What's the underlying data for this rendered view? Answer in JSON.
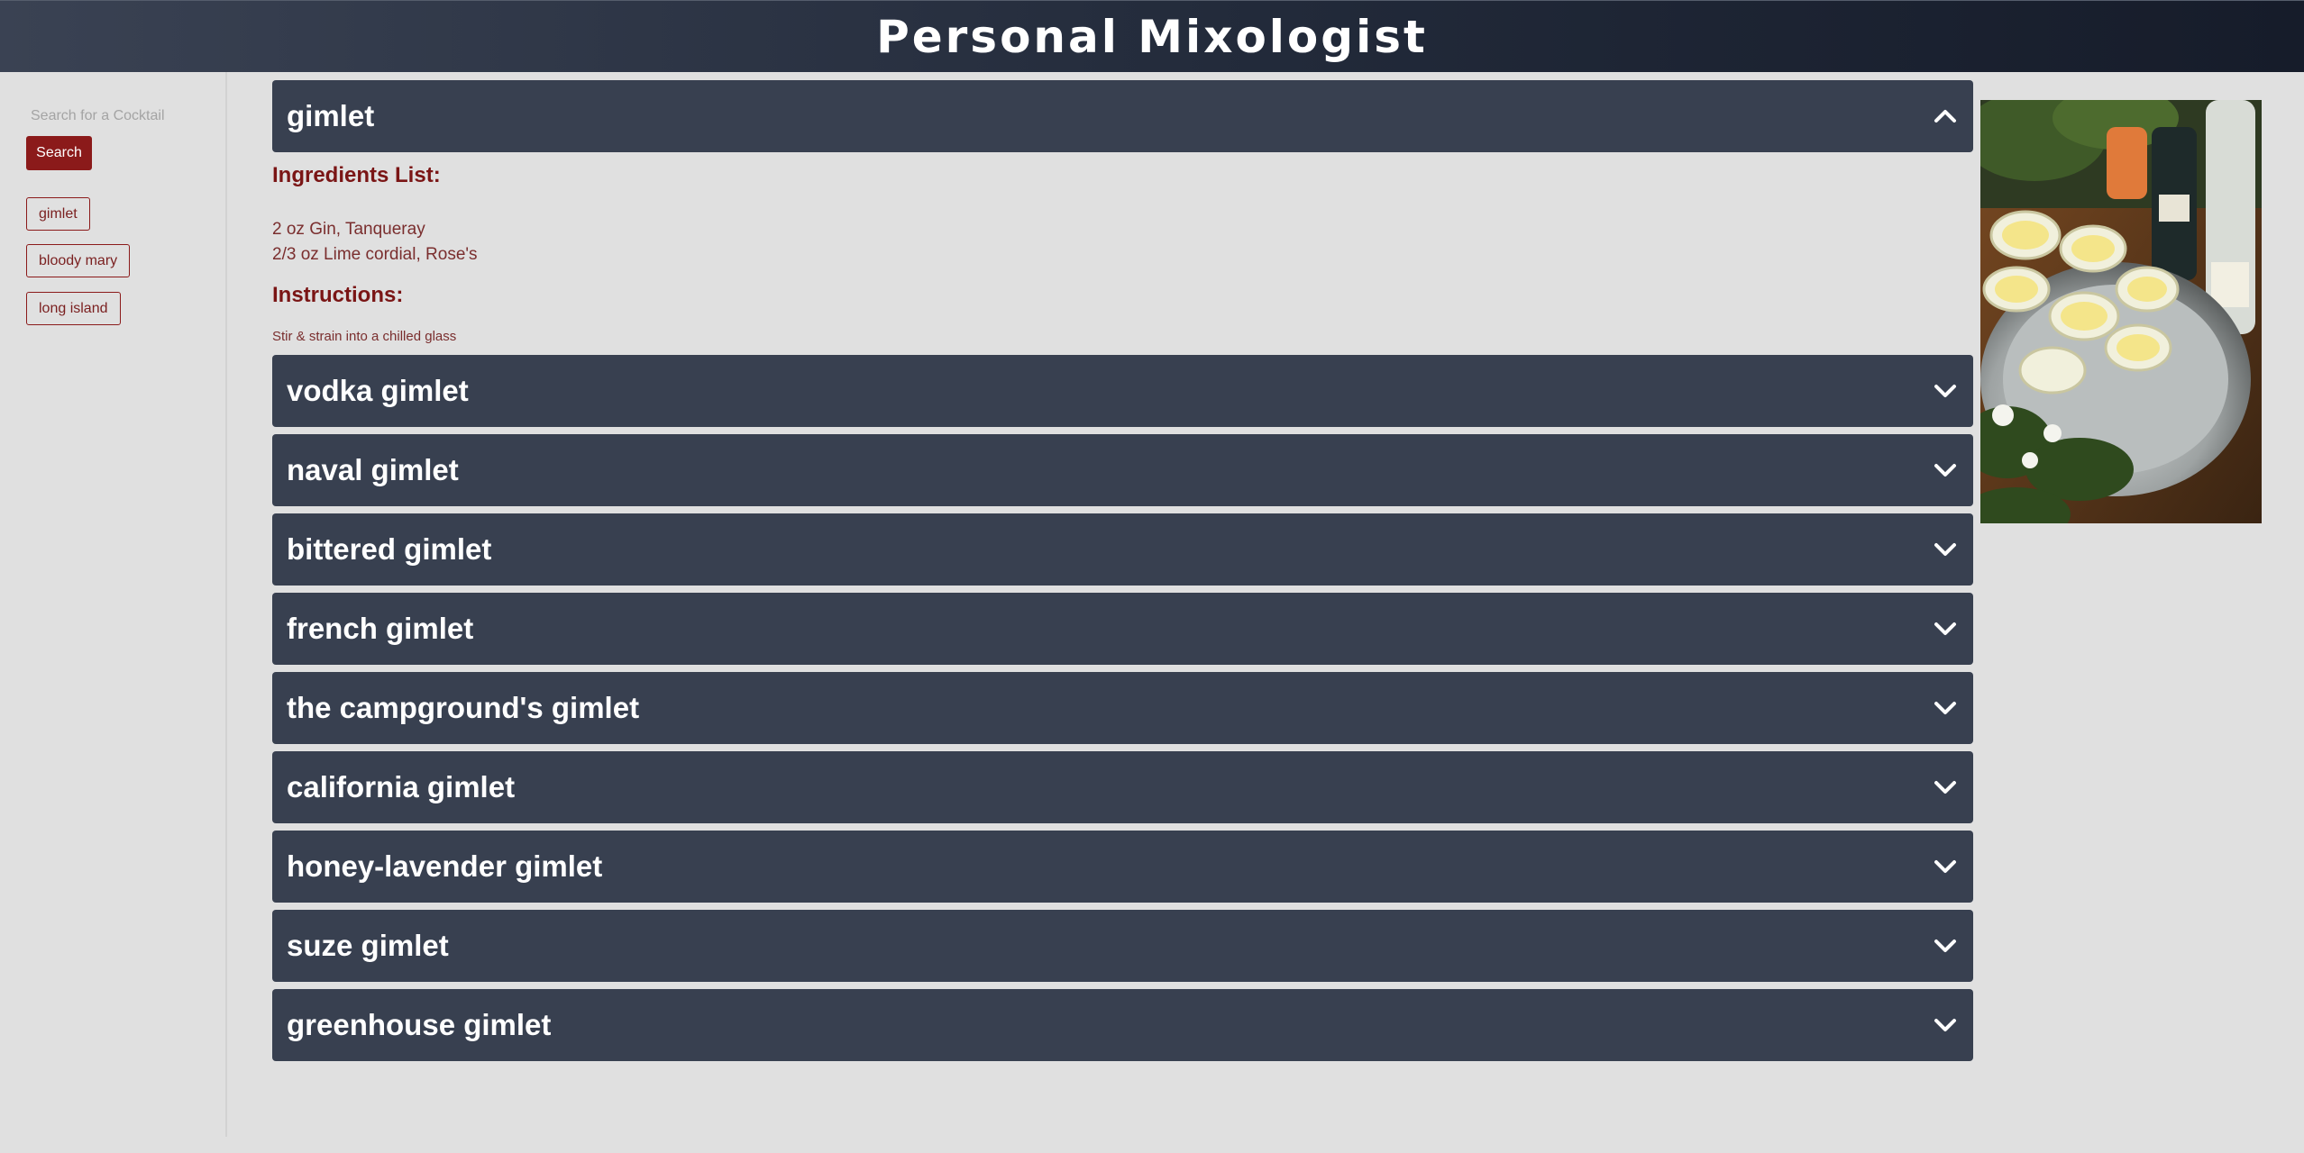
{
  "header": {
    "title": "Personal Mixologist"
  },
  "sidebar": {
    "search_placeholder": "Search for a Cocktail",
    "search_label": "Search",
    "history": [
      {
        "label": "gimlet"
      },
      {
        "label": "bloody mary"
      },
      {
        "label": "long island"
      }
    ]
  },
  "main": {
    "expanded": {
      "title": "gimlet",
      "ingredients_heading": "Ingredients List:",
      "ingredients": [
        "2 oz Gin, Tanqueray",
        "2/3 oz Lime cordial, Rose's"
      ],
      "instructions_heading": "Instructions:",
      "instructions": "Stir & strain into a chilled glass"
    },
    "collapsed": [
      {
        "title": "vodka gimlet"
      },
      {
        "title": "naval gimlet"
      },
      {
        "title": "bittered gimlet"
      },
      {
        "title": "french gimlet"
      },
      {
        "title": "the campground's gimlet"
      },
      {
        "title": "california gimlet"
      },
      {
        "title": "honey-lavender gimlet"
      },
      {
        "title": "suze gimlet"
      },
      {
        "title": "greenhouse gimlet"
      }
    ]
  },
  "colors": {
    "header_bg": "#222a3a",
    "accordion_bg": "#384050",
    "accent": "#8b1a1a",
    "page_bg": "#e0e0e0"
  },
  "icons": {
    "expanded": "chevron-up-icon",
    "collapsed": "chevron-down-icon"
  }
}
